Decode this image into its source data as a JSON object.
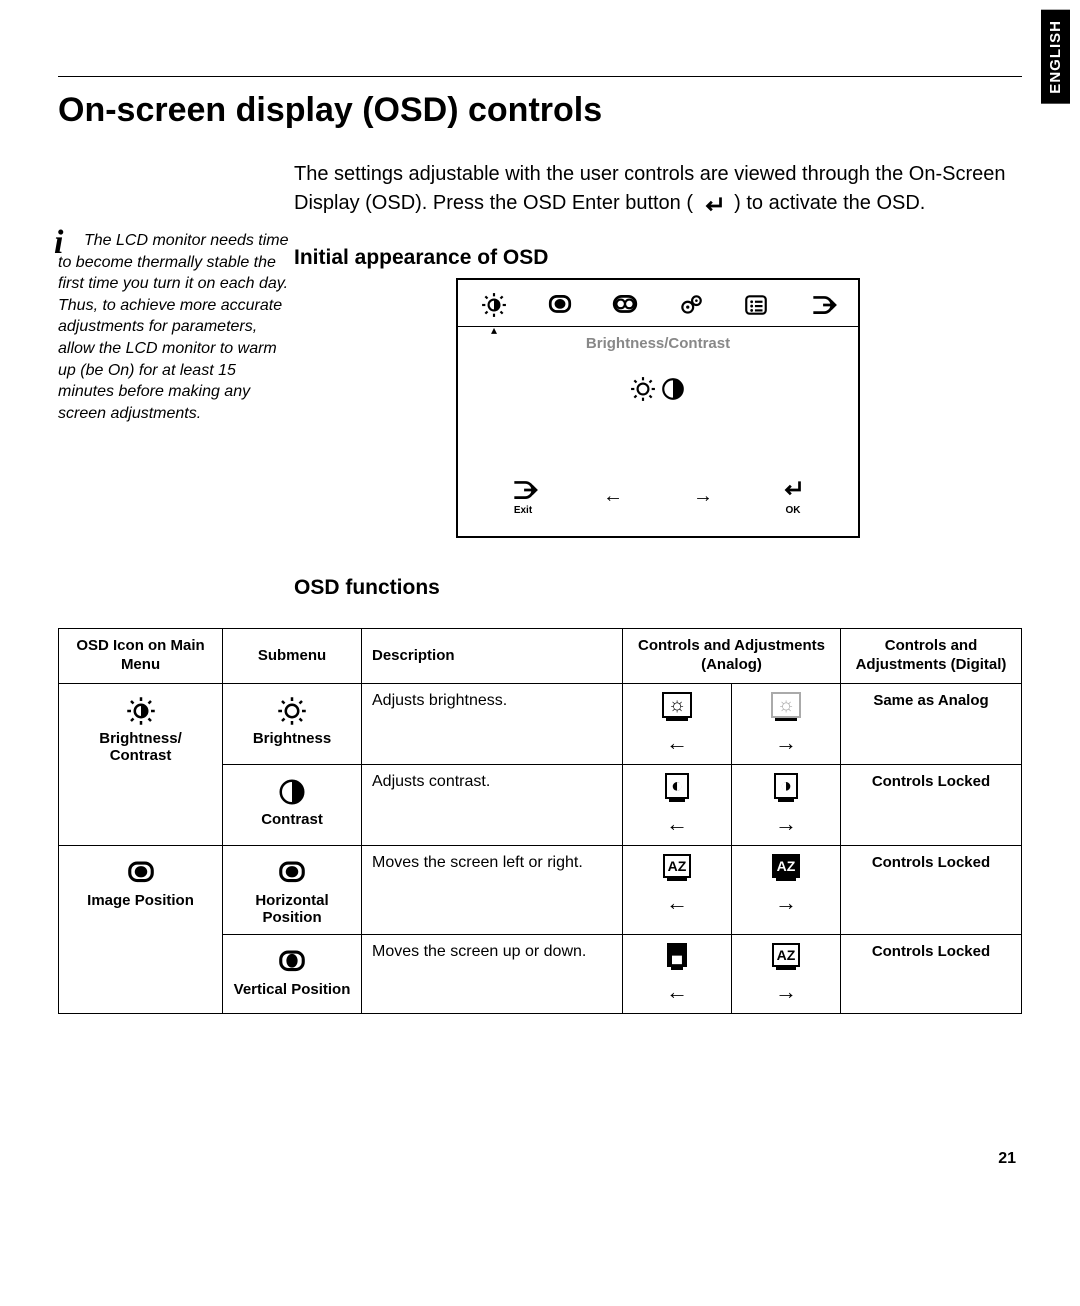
{
  "language_tab": "ENGLISH",
  "title": "On-screen display (OSD) controls",
  "intro_pre": "The settings adjustable with the user controls are viewed through the On-Screen Display (OSD). Press the OSD Enter button (",
  "intro_post": ") to activate the OSD.",
  "sidenote_first": "The LCD monitor needs time to become thermally",
  "sidenote_rest": "stable the first time you turn it on each day. Thus, to achieve more accurate adjustments for parameters, allow the LCD monitor to warm up (be On) for at least 15 minutes before making any screen adjustments.",
  "h2_initial": "Initial appearance of OSD",
  "osd": {
    "label": "Brightness/Contrast",
    "exit": "Exit",
    "ok": "OK"
  },
  "h2_functions": "OSD functions",
  "table": {
    "headers": {
      "icon": "OSD Icon on Main Menu",
      "submenu": "Submenu",
      "description": "Description",
      "analog": "Controls and Adjustments (Analog)",
      "digital": "Controls and Adjustments (Digital)"
    },
    "groups": [
      {
        "main_label": "Brightness/ Contrast",
        "rows": [
          {
            "sub_label": "Brightness",
            "desc": "Adjusts brightness.",
            "digital": "Same as Analog"
          },
          {
            "sub_label": "Contrast",
            "desc": "Adjusts contrast.",
            "digital": "Controls Locked"
          }
        ]
      },
      {
        "main_label": "Image Position",
        "rows": [
          {
            "sub_label": "Horizontal Position",
            "desc": "Moves the screen left or right.",
            "digital": "Controls Locked"
          },
          {
            "sub_label": "Vertical Position",
            "desc": "Moves the screen up or down.",
            "digital": "Controls Locked"
          }
        ]
      }
    ]
  },
  "page_number": "21"
}
